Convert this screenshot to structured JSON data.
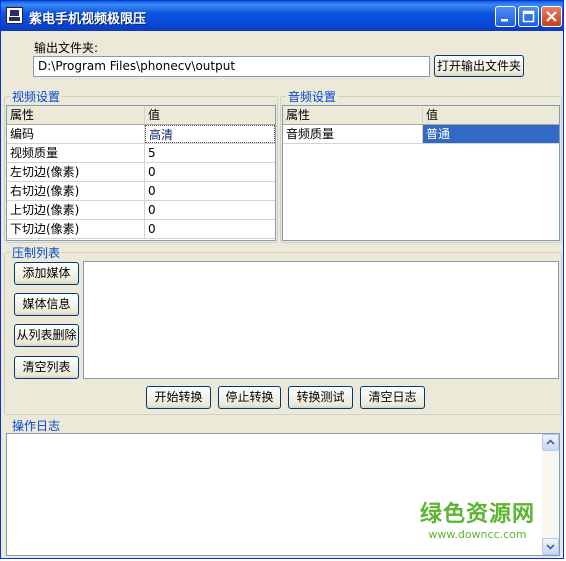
{
  "window": {
    "title": "紫电手机视频极限压"
  },
  "output": {
    "label": "输出文件夹:",
    "path": "D:\\Program Files\\phonecv\\output",
    "open_button": "打开输出文件夹"
  },
  "video_settings": {
    "title": "视频设置",
    "headers": [
      "属性",
      "值"
    ],
    "rows": [
      {
        "prop": "编码",
        "value": "高清"
      },
      {
        "prop": "视频质量",
        "value": "5"
      },
      {
        "prop": "左切边(像素)",
        "value": "0"
      },
      {
        "prop": "右切边(像素)",
        "value": "0"
      },
      {
        "prop": "上切边(像素)",
        "value": "0"
      },
      {
        "prop": "下切边(像素)",
        "value": "0"
      }
    ]
  },
  "audio_settings": {
    "title": "音频设置",
    "headers": [
      "属性",
      "值"
    ],
    "rows": [
      {
        "prop": "音频质量",
        "value": "普通"
      }
    ]
  },
  "compress_list": {
    "title": "压制列表",
    "buttons": [
      "添加媒体",
      "媒体信息",
      "从列表删除",
      "清空列表"
    ]
  },
  "actions": [
    "开始转换",
    "停止转换",
    "转换测试",
    "清空日志"
  ],
  "log": {
    "title": "操作日志"
  },
  "watermark": {
    "text": "绿色资源网",
    "url": "www.downcc.com"
  },
  "colors": {
    "titlebar": "#0a4fd8",
    "group_title": "#0046d5",
    "selection": "#316ac5",
    "watermark": "#5cb531"
  }
}
